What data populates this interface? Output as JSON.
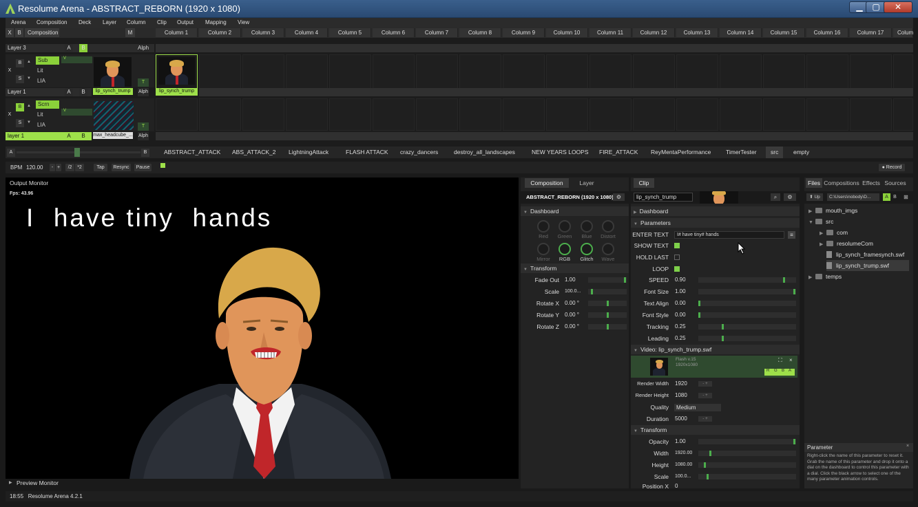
{
  "window": {
    "title": "Resolume Arena - ABSTRACT_REBORN (1920 x 1080)",
    "min": "▁",
    "max": "▢",
    "close": "✕"
  },
  "menu": [
    "Arena",
    "Composition",
    "Deck",
    "Layer",
    "Column",
    "Clip",
    "Output",
    "Mapping",
    "View"
  ],
  "toprow": {
    "x": "X",
    "b": "B",
    "composition": "Composition",
    "m": "M"
  },
  "columns": [
    "Column 1",
    "Column 2",
    "Column 3",
    "Column 4",
    "Column 5",
    "Column 6",
    "Column 7",
    "Column 8",
    "Column 9",
    "Column 10",
    "Column 11",
    "Column 12",
    "Column 13",
    "Column 14",
    "Column 15",
    "Column 16",
    "Column 17",
    "Colum"
  ],
  "layers": {
    "layer3": {
      "name": "Layer 3",
      "a": "A",
      "b": "B",
      "alph": "Alph"
    },
    "layer2": {
      "x": "X",
      "b": "B",
      "s": "S",
      "blend": "Sub",
      "lit": "Lit",
      "lia": "LIA",
      "v": "V",
      "t": "T",
      "clip1": "lip_synch_trump",
      "clip2": "lip_synch_trump",
      "name": "Layer 1",
      "a": "A",
      "bb": "B",
      "alph": "Alph"
    },
    "layer1": {
      "x": "X",
      "b": "B",
      "s": "S",
      "blend": "Scrn",
      "lit": "Lit",
      "lia": "LIA",
      "v": "V",
      "t": "T",
      "clip1": "max_headcube_...",
      "name": "layer 1",
      "a": "A",
      "bb": "B",
      "alph": "Alph"
    }
  },
  "decks": [
    "ABSTRACT_ATTACK",
    "ABS_ATTACK_2",
    "LightningAttack",
    "FLASH ATTACK",
    "crazy_dancers",
    "destroy_all_landscapes",
    "NEW YEARS LOOPS",
    "FIRE_ATTACK",
    "ReyMentaPerformance",
    "TimerTester",
    "src",
    "empty"
  ],
  "deckbar": {
    "a": "A",
    "b": "B"
  },
  "bpm": {
    "label": "BPM",
    "value": "120.00",
    "minus": "-",
    "plus": "+",
    "half": "/2",
    "double": "*2",
    "tap": "Tap",
    "resync": "Resync",
    "pause": "Pause",
    "record": "● Record"
  },
  "output": {
    "label": "Output Monitor",
    "fps": "Fps: 43.96",
    "overlay_text": "I  have tiny  hands"
  },
  "preview": {
    "label": "Preview Monitor"
  },
  "status": {
    "text": "18:55   Resolume Arena 4.2.1"
  },
  "comp_panel": {
    "tabs": [
      "Composition",
      "Layer"
    ],
    "name": "ABSTRACT_REBORN (1920 x 1080)",
    "dashboard": "Dashboard",
    "knobs": [
      {
        "label": "Red"
      },
      {
        "label": "Green"
      },
      {
        "label": "Blue"
      },
      {
        "label": "Distort"
      },
      {
        "label": "Mirror"
      },
      {
        "label": "RGB"
      },
      {
        "label": "Glitch"
      },
      {
        "label": "Wave"
      }
    ],
    "transform": "Transform",
    "params": [
      {
        "label": "Fade Out",
        "value": "1.00"
      },
      {
        "label": "Scale",
        "value": "100.0..."
      },
      {
        "label": "Rotate X",
        "value": "0.00 °"
      },
      {
        "label": "Rotate Y",
        "value": "0.00 °"
      },
      {
        "label": "Rotate Z",
        "value": "0.00 °"
      }
    ]
  },
  "clip_panel": {
    "tab": "Clip",
    "name": "lip_synch_trump",
    "dashboard": "Dashboard",
    "parameters": "Parameters",
    "enter_text_label": "ENTER TEXT",
    "enter_text_value": "I# have tiny# hands",
    "checks": [
      {
        "label": "SHOW TEXT",
        "on": true
      },
      {
        "label": "HOLD LAST",
        "on": false
      },
      {
        "label": "LOOP",
        "on": true
      }
    ],
    "sliders": [
      {
        "label": "SPEED",
        "value": "0.90"
      },
      {
        "label": "Font Size",
        "value": "1.00"
      },
      {
        "label": "Text Align",
        "value": "0.00"
      },
      {
        "label": "Font Style",
        "value": "0.00"
      },
      {
        "label": "Tracking",
        "value": "0.25"
      },
      {
        "label": "Leading",
        "value": "0.25"
      }
    ],
    "video_header": "Video: lip_synch_trump.swf",
    "video_info1": "Flash v.15",
    "video_info2": "1920x1080",
    "rgba": [
      "R",
      "G",
      "B",
      "A"
    ],
    "video_params": [
      {
        "label": "Render Width",
        "value": "1920"
      },
      {
        "label": "Render Height",
        "value": "1080"
      },
      {
        "label": "Quality",
        "value": "Medium"
      },
      {
        "label": "Duration",
        "value": "5000"
      }
    ],
    "transform": "Transform",
    "transform_params": [
      {
        "label": "Opacity",
        "value": "1.00"
      },
      {
        "label": "Width",
        "value": "1920.00"
      },
      {
        "label": "Height",
        "value": "1080.00"
      },
      {
        "label": "Scale",
        "value": "100.0..."
      },
      {
        "label": "Position X",
        "value": "0"
      }
    ]
  },
  "files_panel": {
    "tabs": [
      "Files",
      "Compositions",
      "Effects",
      "Sources"
    ],
    "up": "Up",
    "path": "C:\\Users\\nobody\\D...",
    "a": "A",
    "b": "B",
    "tree": [
      {
        "name": "mouth_imgs",
        "type": "folder",
        "depth": 0,
        "arrow": "▶"
      },
      {
        "name": "src",
        "type": "folder",
        "depth": 0,
        "arrow": "▼"
      },
      {
        "name": "com",
        "type": "folder",
        "depth": 1,
        "arrow": "▶"
      },
      {
        "name": "resolumeCom",
        "type": "folder",
        "depth": 1,
        "arrow": "▶"
      },
      {
        "name": "lip_synch_framesynch.swf",
        "type": "file",
        "depth": 1,
        "arrow": ""
      },
      {
        "name": "lip_synch_trump.swf",
        "type": "file",
        "depth": 1,
        "arrow": "",
        "selected": true
      },
      {
        "name": "temps",
        "type": "folder",
        "depth": 0,
        "arrow": "▶"
      }
    ],
    "help_title": "Parameter",
    "help_text": "Right-click the name of this parameter to reset it. Grab the name of this parameter and drop it onto a dial on the dashboard to control this parameter with a dial. Click the black arrow to select one of the many parameter animation controls."
  },
  "colors": {
    "accent_green": "#9ee04a",
    "title_blue": "#2a4a72",
    "tie_red": "#c0262a"
  }
}
